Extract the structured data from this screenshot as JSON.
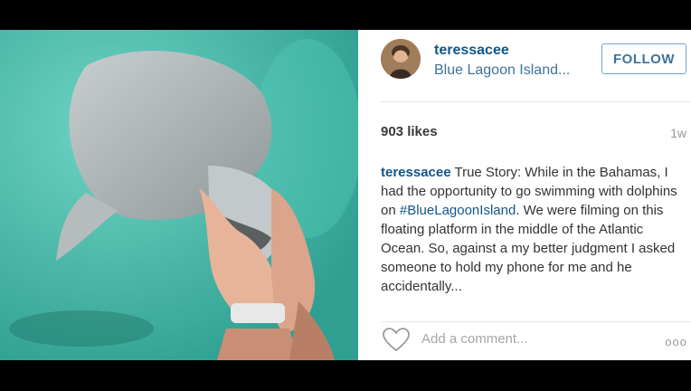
{
  "post": {
    "username": "teressacee",
    "location": "Blue Lagoon Island...",
    "follow_label": "FOLLOW",
    "likes": "903 likes",
    "time": "1w",
    "caption_user": "teressacee",
    "caption_part1": " True Story: While in the Bahamas, I had the opportunity to go swimming with dolphins on ",
    "caption_hashtag": "#BlueLagoonIsland",
    "caption_part2": ". We were filming on this floating platform in the middle of the Atlantic Ocean. So, against a my better judgment I asked someone to hold my phone for me and he accidentally...",
    "comment_placeholder": "Add a comment...",
    "more_label": "ooo"
  },
  "icons": {
    "like": "heart-icon",
    "more": "more-options-icon"
  },
  "colors": {
    "username": "#125688",
    "link": "#3f729b",
    "water": "#3fb5a6"
  }
}
